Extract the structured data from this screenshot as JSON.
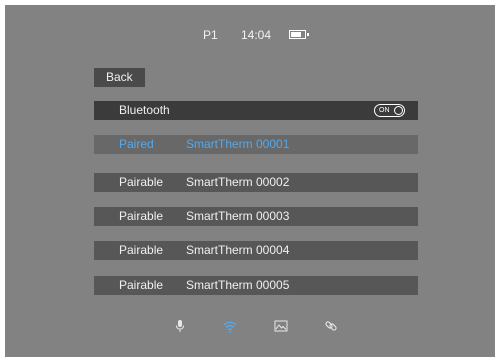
{
  "status_bar": {
    "profile": "P1",
    "time": "14:04",
    "battery_level": 0.8
  },
  "back_label": "Back",
  "bluetooth": {
    "label": "Bluetooth",
    "toggle": "ON"
  },
  "devices": [
    {
      "status": "Paired",
      "name": "SmartTherm 00001"
    },
    {
      "status": "Pairable",
      "name": "SmartTherm 00002"
    },
    {
      "status": "Pairable",
      "name": "SmartTherm 00003"
    },
    {
      "status": "Pairable",
      "name": "SmartTherm 00004"
    },
    {
      "status": "Pairable",
      "name": "SmartTherm 00005"
    }
  ],
  "bottom_nav": [
    "microphone-icon",
    "wifi-icon",
    "image-icon",
    "link-icon"
  ],
  "colors": {
    "background": "#828282",
    "selected_text": "#53a9ee",
    "active_icon": "#53a9ee"
  }
}
